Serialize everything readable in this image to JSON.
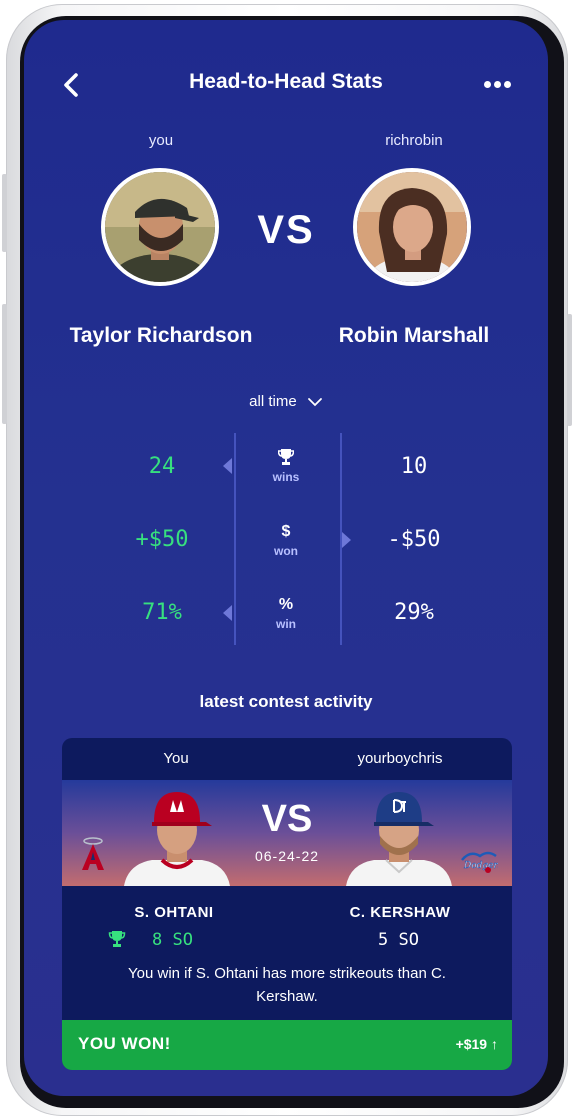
{
  "header": {
    "title": "Head-to-Head Stats",
    "back_icon": "chevron-left-icon",
    "more_icon": "more-dots-icon"
  },
  "players": {
    "left": {
      "username": "you",
      "full_name": "Taylor Richardson"
    },
    "right": {
      "username": "richrobin",
      "full_name": "Robin Marshall"
    },
    "vs_label": "VS"
  },
  "filter": {
    "label": "all time"
  },
  "stats": [
    {
      "left": "24",
      "icon": "trophy-icon",
      "icon_text": "",
      "label": "wins",
      "right": "10",
      "leader": "left"
    },
    {
      "left": "+$50",
      "icon": "dollar-icon",
      "icon_text": "$",
      "label": "won",
      "right": "-$50",
      "leader": "right"
    },
    {
      "left": "71%",
      "icon": "percent-icon",
      "icon_text": "%",
      "label": "win",
      "right": "29%",
      "leader": "left"
    }
  ],
  "activity": {
    "section_title": "latest contest activity",
    "left_user": "You",
    "right_user": "yourboychris",
    "vs_label": "VS",
    "date": "06-24-22",
    "left_player": {
      "name": "S. OHTANI",
      "value": "8 SO",
      "team_logo": "angels-logo"
    },
    "right_player": {
      "name": "C. KERSHAW",
      "value": "5 SO",
      "team_logo": "dodgers-logo"
    },
    "condition": "You win if S. Ohtani has more strikeouts than C. Kershaw.",
    "result_label": "YOU WON!",
    "payout": "+$19 ↑"
  },
  "colors": {
    "screen_bg": "#1f2a8e",
    "win_green": "#37e07f",
    "result_green": "#17a845",
    "card_bg": "#0d1a5e"
  }
}
